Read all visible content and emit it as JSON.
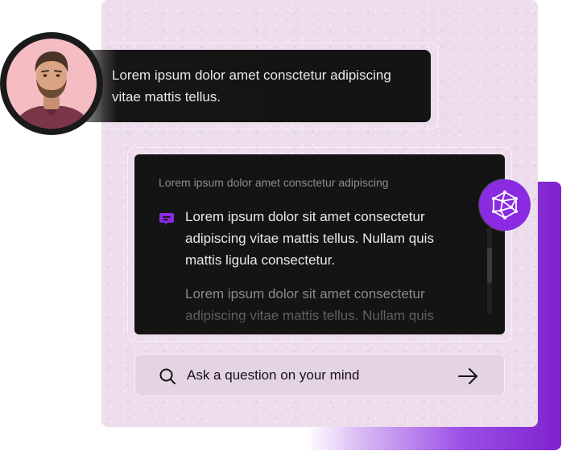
{
  "user_message": {
    "text": "Lorem ipsum dolor amet consctetur adipiscing vitae mattis tellus."
  },
  "answer": {
    "subtitle": "Lorem ipsum dolor amet consctetur adipiscing",
    "paragraphs": [
      "Lorem ipsum dolor sit amet consectetur adipiscing vitae mattis tellus. Nullam quis mattis ligula consectetur.",
      "Lorem ipsum dolor sit amet consectetur adipiscing vitae mattis tellus. Nullam quis"
    ]
  },
  "search": {
    "placeholder": "Ask a question on your mind"
  },
  "icons": {
    "avatar": "user-avatar",
    "answer_bullet": "chat-bubble-icon",
    "ai_badge": "ai-crystal-icon",
    "search": "search-icon",
    "send": "arrow-right-icon"
  },
  "colors": {
    "accent": "#8a2be2",
    "panel": "#ecdcec",
    "dark": "#141414",
    "text_light": "#e9e9ea"
  }
}
